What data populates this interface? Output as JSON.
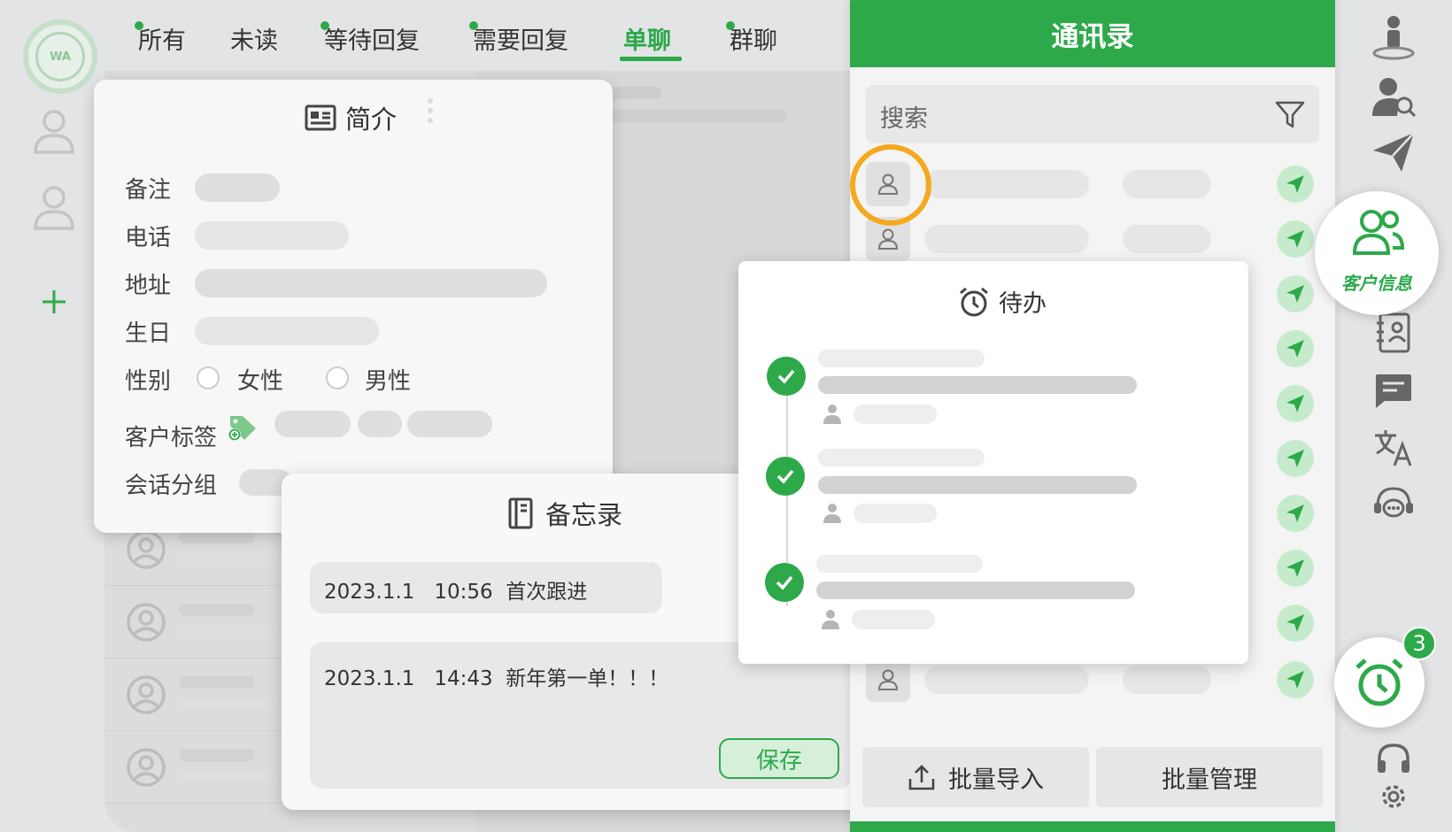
{
  "tabs": [
    {
      "label": "所有",
      "dot": true
    },
    {
      "label": "未读",
      "dot": false
    },
    {
      "label": "等待回复",
      "dot": true
    },
    {
      "label": "需要回复",
      "dot": true
    },
    {
      "label": "单聊",
      "dot": false,
      "active": true
    },
    {
      "label": "群聊",
      "dot": true
    }
  ],
  "logo": {
    "text": "WA"
  },
  "profile": {
    "title": "简介",
    "fields": {
      "remark": "备注",
      "phone": "电话",
      "address": "地址",
      "birthday": "生日",
      "gender": "性别",
      "female": "女性",
      "male": "男性",
      "tags": "客户标签",
      "group": "会话分组"
    }
  },
  "memo": {
    "title": "备忘录",
    "entries": [
      "2023.1.1   10:56  首次跟进",
      "2023.1.1   14:43  新年第一单！！！"
    ],
    "save_label": "保存"
  },
  "contacts": {
    "title": "通讯录",
    "search_placeholder": "搜索",
    "import_label": "批量导入",
    "manage_label": "批量管理"
  },
  "todo": {
    "title": "待办"
  },
  "right_rail": {
    "customer_info_label": "客户信息",
    "todo_badge": "3"
  },
  "colors": {
    "accent": "#2da94a",
    "highlight": "#f4a91e"
  }
}
